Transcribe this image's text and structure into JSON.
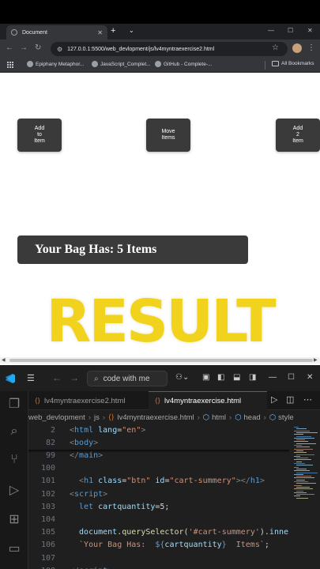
{
  "browser": {
    "tab_title": "Document",
    "url": "127.0.0.1:5500/web_devlopment/js/lv4myntraexercise2.html",
    "bookmarks": [
      "Epiphany Metaphor...",
      "JavaScript_Complet...",
      "GitHub - Complete-..."
    ],
    "all_bookmarks_label": "All Bookmarks"
  },
  "page": {
    "buttons": {
      "add_to_item": "Add\nto\nItem",
      "move_items": "Move\nItems",
      "add_2_item": "Add\n2\nItem"
    },
    "bag_text": "Your Bag Has: 5 Items"
  },
  "overlay": {
    "result_text": "RESULT"
  },
  "vscode": {
    "search_label": "code with me",
    "tabs": [
      {
        "label": "lv4myntraexercise2.html",
        "active": false
      },
      {
        "label": "lv4myntraexercise.html",
        "active": true
      }
    ],
    "breadcrumbs": [
      "web_devlopment",
      "js",
      "lv4myntraexercise.html",
      "html",
      "head",
      "style"
    ],
    "sticky_lines": [
      {
        "num": "2",
        "tokens": [
          [
            "<",
            "t-br"
          ],
          [
            "html",
            "t-tag"
          ],
          [
            " lang",
            "t-attr"
          ],
          [
            "=",
            "t-pl"
          ],
          [
            "\"en\"",
            "t-str"
          ],
          [
            ">",
            "t-br"
          ]
        ]
      },
      {
        "num": "82",
        "tokens": [
          [
            "<",
            "t-br"
          ],
          [
            "body",
            "t-tag"
          ],
          [
            ">",
            "t-br"
          ]
        ]
      }
    ],
    "code_lines": [
      {
        "num": "99",
        "tokens": [
          [
            "</",
            "t-br"
          ],
          [
            "main",
            "t-tag"
          ],
          [
            ">",
            "t-br"
          ]
        ]
      },
      {
        "num": "100",
        "tokens": []
      },
      {
        "num": "101",
        "tokens": [
          [
            "  <",
            "t-br"
          ],
          [
            "h1",
            "t-tag"
          ],
          [
            " class",
            "t-attr"
          ],
          [
            "=",
            "t-pl"
          ],
          [
            "\"btn\"",
            "t-str"
          ],
          [
            " id",
            "t-attr"
          ],
          [
            "=",
            "t-pl"
          ],
          [
            "\"cart-summery\"",
            "t-str"
          ],
          [
            "></",
            "t-br"
          ],
          [
            "h1",
            "t-tag"
          ],
          [
            ">",
            "t-br"
          ]
        ]
      },
      {
        "num": "102",
        "tokens": [
          [
            "<",
            "t-br"
          ],
          [
            "script",
            "t-tag"
          ],
          [
            ">",
            "t-br"
          ]
        ]
      },
      {
        "num": "103",
        "tokens": [
          [
            "  let ",
            "t-kw"
          ],
          [
            "cartquantity",
            "t-var"
          ],
          [
            "=5;",
            "t-pl"
          ]
        ]
      },
      {
        "num": "104",
        "tokens": []
      },
      {
        "num": "105",
        "tokens": [
          [
            "  document",
            "t-var"
          ],
          [
            ".",
            "t-pl"
          ],
          [
            "querySelector",
            "t-fn"
          ],
          [
            "(",
            "t-pl"
          ],
          [
            "'#cart-summery'",
            "t-str"
          ],
          [
            ").",
            "t-pl"
          ],
          [
            "inne",
            "t-var"
          ]
        ]
      },
      {
        "num": "106",
        "tokens": [
          [
            "  `Your Bag Has:  ",
            "t-str"
          ],
          [
            "${",
            "t-kw"
          ],
          [
            "cartquantity",
            "t-var"
          ],
          [
            "}",
            "t-kw"
          ],
          [
            "  Items`",
            "t-str"
          ],
          [
            ";",
            "t-pl"
          ]
        ]
      },
      {
        "num": "107",
        "tokens": []
      },
      {
        "num": "108",
        "tokens": [
          [
            "</",
            "t-br"
          ],
          [
            "script",
            "t-tag"
          ],
          [
            ">",
            "t-br"
          ]
        ]
      }
    ]
  },
  "colors": {
    "result_yellow": "#f1d21c",
    "button_dark": "#3a3a3a",
    "vscode_bg": "#1f1f1f"
  }
}
